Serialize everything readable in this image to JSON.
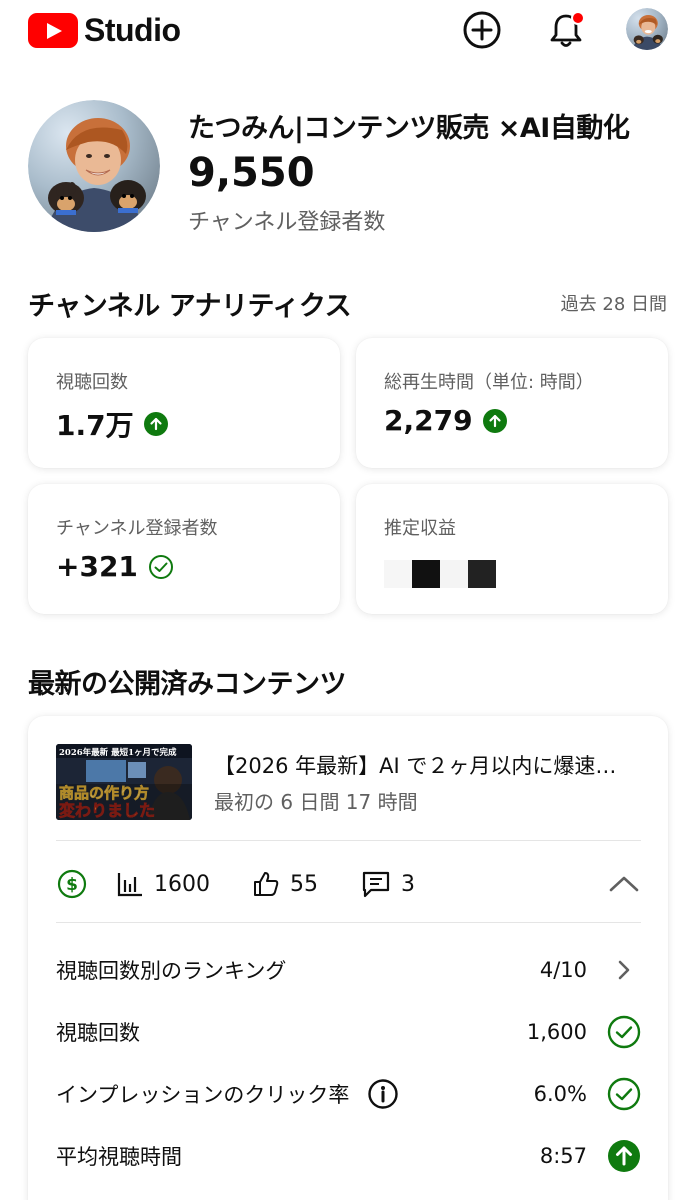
{
  "header": {
    "logo_text": "Studio",
    "create_icon": "plus-circle-icon",
    "notifications_icon": "bell-icon",
    "notification_dot_color": "#ff0000"
  },
  "channel": {
    "name": "たつみん|コンテンツ販売 ×AI自動化",
    "subscriber_count": "9,550",
    "subscriber_label": "チャンネル登録者数"
  },
  "analytics": {
    "title": "チャンネル アナリティクス",
    "period": "過去 28 日間",
    "cards": [
      {
        "label": "視聴回数",
        "value": "1.7万",
        "status": "up-arrow-icon"
      },
      {
        "label": "総再生時間（単位: 時間）",
        "value": "2,279",
        "status": "up-arrow-icon"
      },
      {
        "label": "チャンネル登録者数",
        "value": "+321",
        "status": "check-circle-icon"
      },
      {
        "label": "推定収益",
        "value": "",
        "status": "censored-blocks"
      }
    ]
  },
  "latest": {
    "title": "最新の公開済みコンテンツ",
    "video": {
      "title": "【2026 年最新】AI で２ヶ月以内に爆速…",
      "subtitle": "最初の 6 日間 17 時間",
      "thumbnail_text_top": "2026年最新 最短1ヶ月で完成",
      "thumbnail_text_main1": "商品の作り方",
      "thumbnail_text_main2": "変わりました"
    },
    "stats": {
      "views": "1600",
      "likes": "55",
      "comments": "3"
    },
    "details": [
      {
        "label": "視聴回数別のランキング",
        "value": "4/10",
        "icon": "chevron-right-icon"
      },
      {
        "label": "視聴回数",
        "value": "1,600",
        "icon": "check-circle-icon"
      },
      {
        "label": "インプレッションのクリック率",
        "value": "6.0%",
        "icon": "check-circle-icon",
        "info_icon": "info-icon"
      },
      {
        "label": "平均視聴時間",
        "value": "8:57",
        "icon": "up-arrow-icon"
      }
    ]
  },
  "colors": {
    "brand_red": "#ff0000",
    "positive_green": "#0f7a0f",
    "secondary_text": "#606060"
  }
}
